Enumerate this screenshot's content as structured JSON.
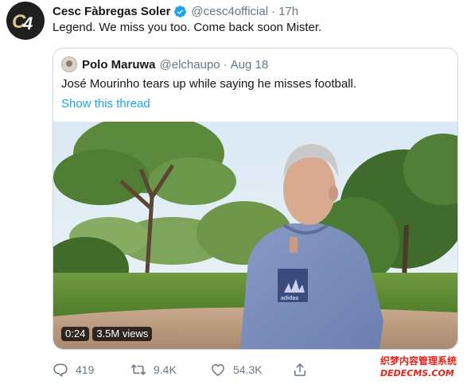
{
  "tweet": {
    "author_name": "Cesc Fàbregas Soler",
    "author_handle": "@cesc4official",
    "separator": "·",
    "time": "17h",
    "text": "Legend. We miss you too. Come back soon Mister."
  },
  "quote": {
    "author_name": "Polo Maruwa",
    "author_handle": "@elchaupo",
    "separator": "·",
    "date": "Aug 18",
    "text": "José Mourinho tears up while saying he misses football.",
    "thread_link": "Show this thread",
    "video": {
      "duration": "0:24",
      "views": "3.5M views"
    }
  },
  "actions": {
    "replies": "419",
    "retweets": "9.4K",
    "likes": "54.3K"
  },
  "icons": {
    "avatar": "c4-logo-avatar",
    "verified": "verified-badge-icon",
    "reply": "reply-icon",
    "retweet": "retweet-icon",
    "like": "heart-icon",
    "share": "share-icon"
  },
  "colors": {
    "link": "#1da1f2",
    "secondary_text": "#657786",
    "verified": "#1da1f2",
    "watermark": "#e2231a"
  },
  "watermark": {
    "line1": "织梦内容管理系统",
    "line2": "DEDECMS.COM"
  }
}
